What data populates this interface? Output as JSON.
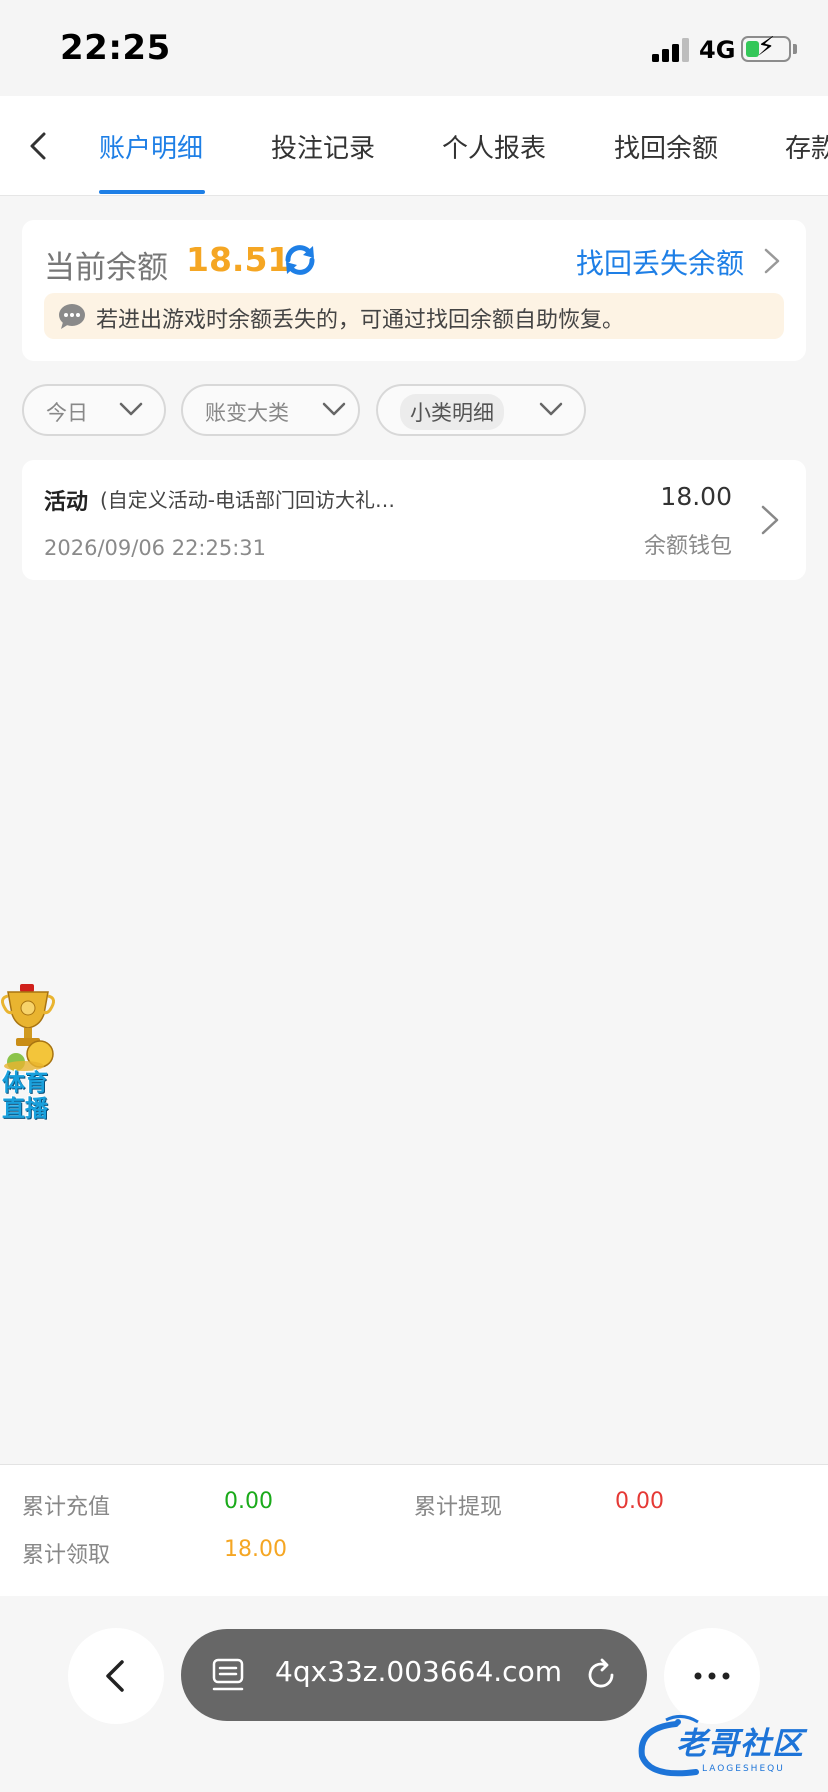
{
  "status_bar": {
    "time": "22:25",
    "network": "4G"
  },
  "tabs": [
    {
      "label": "账户明细",
      "active": true
    },
    {
      "label": "投注记录",
      "active": false
    },
    {
      "label": "个人报表",
      "active": false
    },
    {
      "label": "找回余额",
      "active": false
    },
    {
      "label": "存款",
      "active": false
    }
  ],
  "balance": {
    "label": "当前余额",
    "amount": "18.51",
    "recover_link": "找回丢失余额",
    "notice": "若进出游戏时余额丢失的，可通过找回余额自助恢复。"
  },
  "filters": [
    {
      "label": "今日"
    },
    {
      "label": "账变大类"
    },
    {
      "label": "小类明细"
    }
  ],
  "records": [
    {
      "type": "活动",
      "description": "(自定义活动-电话部门回访大礼…",
      "time": "2026/09/06 22:25:31",
      "amount": "18.00",
      "wallet": "余额钱包"
    }
  ],
  "float_badge": {
    "line1": "体育",
    "line2": "直播"
  },
  "summary": {
    "total_deposit_label": "累计充值",
    "total_deposit_value": "0.00",
    "total_withdraw_label": "累计提现",
    "total_withdraw_value": "0.00",
    "total_claim_label": "累计领取",
    "total_claim_value": "18.00"
  },
  "browser": {
    "url": "4qx33z.003664.com"
  },
  "watermark": {
    "text": "老哥社区",
    "subtext": "LAOGESHEQU"
  },
  "colors": {
    "accent": "#1e7fe6",
    "balance": "#f5a623",
    "positive": "#1aaa1a",
    "negative": "#e53935",
    "notice_bg": "#fdf3e4"
  }
}
